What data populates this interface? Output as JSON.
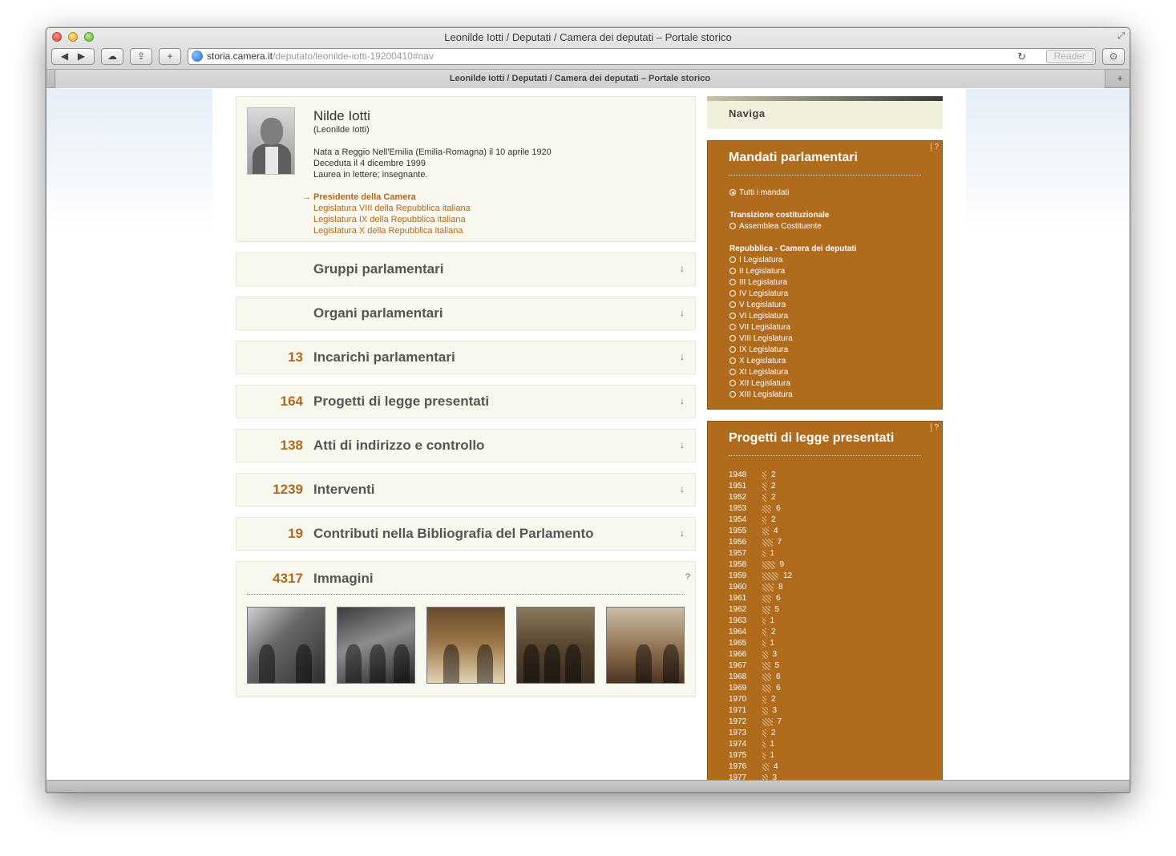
{
  "window": {
    "title": "Leonilde Iotti / Deputati / Camera dei deputati – Portale storico",
    "url_host": "storia.camera.it",
    "url_path": "/deputato/leonilde-iotti-19200410#nav",
    "reader_label": "Reader",
    "tab_title": "Leonilde Iotti / Deputati / Camera dei deputati – Portale storico"
  },
  "profile": {
    "name": "Nilde Iotti",
    "full_name": "(Leonilde Iotti)",
    "birth": "Nata a Reggio Nell'Emilia (Emilia-Romagna) il 10 aprile 1920",
    "death": "Deceduta il 4 dicembre 1999",
    "education": "Laurea in lettere; insegnante.",
    "roles": [
      "Presidente della Camera",
      "Legislatura VIII della Repubblica italiana",
      "Legislatura IX della Repubblica italiana",
      "Legislatura X della Repubblica italiana"
    ]
  },
  "sections": [
    {
      "count": "",
      "label": "Gruppi parlamentari"
    },
    {
      "count": "",
      "label": "Organi parlamentari"
    },
    {
      "count": "13",
      "label": "Incarichi parlamentari"
    },
    {
      "count": "164",
      "label": "Progetti di legge presentati"
    },
    {
      "count": "138",
      "label": "Atti di indirizzo e controllo"
    },
    {
      "count": "1239",
      "label": "Interventi"
    },
    {
      "count": "19",
      "label": "Contributi nella Bibliografia del Parlamento"
    }
  ],
  "images": {
    "count": "4317",
    "label": "Immagini",
    "help": "?"
  },
  "naviga": {
    "title": "Naviga"
  },
  "mandati": {
    "title": "Mandati parlamentari",
    "help": "?",
    "all": "Tutti i mandati",
    "group1": "Transizione costituzionale",
    "group1_items": [
      "Assemblea Costituente"
    ],
    "group2": "Repubblica - Camera dei deputati",
    "group2_items": [
      "I Legislatura",
      "II Legislatura",
      "III Legislatura",
      "IV Legislatura",
      "V Legislatura",
      "VI Legislatura",
      "VII Legislatura",
      "VIII Legislatura",
      "IX Legislatura",
      "X Legislatura",
      "XI Legislatura",
      "XII Legislatura",
      "XIII Legislatura"
    ]
  },
  "progetti": {
    "title": "Progetti di legge presentati",
    "help": "?",
    "years": [
      {
        "year": "1948",
        "count": "2"
      },
      {
        "year": "1951",
        "count": "2"
      },
      {
        "year": "1952",
        "count": "2"
      },
      {
        "year": "1953",
        "count": "6"
      },
      {
        "year": "1954",
        "count": "2"
      },
      {
        "year": "1955",
        "count": "4"
      },
      {
        "year": "1956",
        "count": "7"
      },
      {
        "year": "1957",
        "count": "1"
      },
      {
        "year": "1958",
        "count": "9"
      },
      {
        "year": "1959",
        "count": "12"
      },
      {
        "year": "1960",
        "count": "8"
      },
      {
        "year": "1961",
        "count": "6"
      },
      {
        "year": "1962",
        "count": "5"
      },
      {
        "year": "1963",
        "count": "1"
      },
      {
        "year": "1964",
        "count": "2"
      },
      {
        "year": "1965",
        "count": "1"
      },
      {
        "year": "1966",
        "count": "3"
      },
      {
        "year": "1967",
        "count": "5"
      },
      {
        "year": "1968",
        "count": "6"
      },
      {
        "year": "1969",
        "count": "6"
      },
      {
        "year": "1970",
        "count": "2"
      },
      {
        "year": "1971",
        "count": "3"
      },
      {
        "year": "1972",
        "count": "7"
      },
      {
        "year": "1973",
        "count": "2"
      },
      {
        "year": "1974",
        "count": "1"
      },
      {
        "year": "1975",
        "count": "1"
      },
      {
        "year": "1976",
        "count": "4"
      },
      {
        "year": "1977",
        "count": "3"
      }
    ]
  }
}
